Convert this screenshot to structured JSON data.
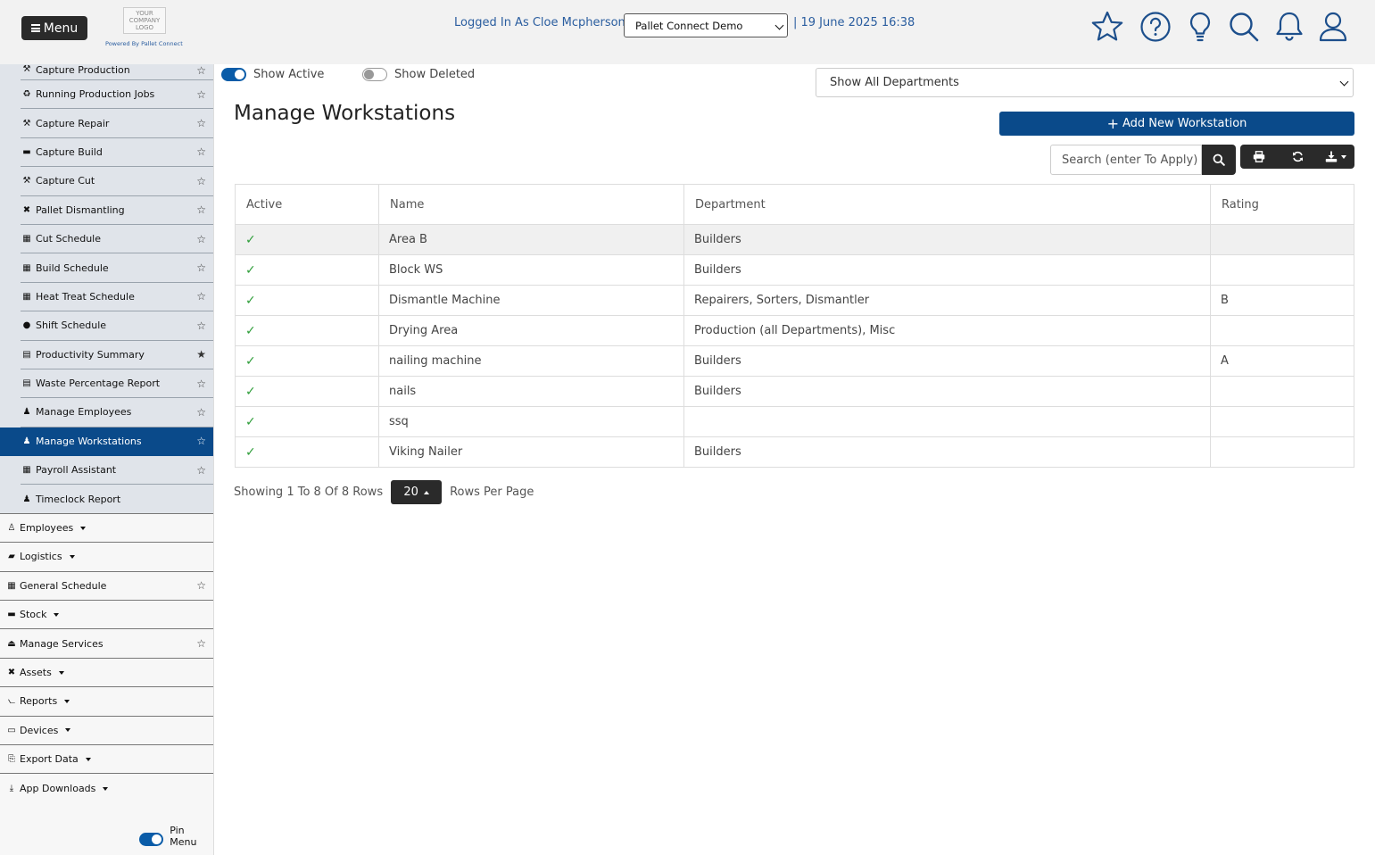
{
  "header": {
    "menu_label": "Menu",
    "logo_text": "YOUR COMPANY LOGO",
    "powered_by": "Powered By Pallet Connect",
    "logged_in": "Logged In As Cloe Mcpherson  |",
    "company": "Pallet Connect Demo",
    "datetime": "| 19 June 2025 16:38",
    "icons": [
      "star-icon",
      "help-icon",
      "lightbulb-icon",
      "search-icon",
      "bell-icon",
      "user-icon"
    ]
  },
  "sidebar": {
    "sub_items": [
      {
        "label": "Capture Production",
        "glyph": "⚒",
        "starred": false
      },
      {
        "label": "Running Production Jobs",
        "glyph": "♻",
        "starred": false
      },
      {
        "label": "Capture Repair",
        "glyph": "⚒",
        "starred": false
      },
      {
        "label": "Capture Build",
        "glyph": "▬",
        "starred": false
      },
      {
        "label": "Capture Cut",
        "glyph": "⚒",
        "starred": false
      },
      {
        "label": "Pallet Dismantling",
        "glyph": "✖",
        "starred": false
      },
      {
        "label": "Cut Schedule",
        "glyph": "▦",
        "starred": false
      },
      {
        "label": "Build Schedule",
        "glyph": "▦",
        "starred": false
      },
      {
        "label": "Heat Treat Schedule",
        "glyph": "▦",
        "starred": false
      },
      {
        "label": "Shift Schedule",
        "glyph": "●",
        "starred": false
      },
      {
        "label": "Productivity Summary",
        "glyph": "▤",
        "starred": true
      },
      {
        "label": "Waste Percentage Report",
        "glyph": "▤",
        "starred": false
      },
      {
        "label": "Manage Employees",
        "glyph": "♟",
        "starred": false
      },
      {
        "label": "Manage Workstations",
        "glyph": "♟",
        "starred": false,
        "active": true
      },
      {
        "label": "Payroll Assistant",
        "glyph": "▦",
        "starred": false
      },
      {
        "label": "Timeclock Report",
        "glyph": "♟",
        "starred": null
      }
    ],
    "main_items": [
      {
        "label": "Employees",
        "glyph": "♙",
        "dropdown": true
      },
      {
        "label": "Logistics",
        "glyph": "▰",
        "dropdown": true
      },
      {
        "label": "General Schedule",
        "glyph": "▦",
        "dropdown": false,
        "star": true
      },
      {
        "label": "Stock",
        "glyph": "▬",
        "dropdown": true
      },
      {
        "label": "Manage Services",
        "glyph": "⏏",
        "dropdown": false,
        "star": true
      },
      {
        "label": "Assets",
        "glyph": "✖",
        "dropdown": true
      },
      {
        "label": "Reports",
        "glyph": "⦦",
        "dropdown": true
      },
      {
        "label": "Devices",
        "glyph": "▭",
        "dropdown": true
      },
      {
        "label": "Export Data",
        "glyph": "⎘",
        "dropdown": true
      },
      {
        "label": "App Downloads",
        "glyph": "⤓",
        "dropdown": true
      }
    ],
    "pin_label": "Pin Menu"
  },
  "filters": {
    "show_active": "Show Active",
    "show_deleted": "Show Deleted",
    "department": "Show All Departments"
  },
  "page": {
    "title": "Manage Workstations",
    "add_button": "Add New Workstation",
    "search_placeholder": "Search (enter To Apply)"
  },
  "table": {
    "columns": [
      "Active",
      "Name",
      "Department",
      "Rating"
    ],
    "rows": [
      {
        "active": "✓",
        "name": "Area B",
        "department": "Builders",
        "rating": ""
      },
      {
        "active": "✓",
        "name": "Block WS",
        "department": "Builders",
        "rating": ""
      },
      {
        "active": "✓",
        "name": "Dismantle Machine",
        "department": "Repairers, Sorters, Dismantler",
        "rating": "B"
      },
      {
        "active": "✓",
        "name": "Drying Area",
        "department": "Production (all Departments), Misc",
        "rating": ""
      },
      {
        "active": "✓",
        "name": "nailing machine",
        "department": "Builders",
        "rating": "A"
      },
      {
        "active": "✓",
        "name": "nails",
        "department": "Builders",
        "rating": ""
      },
      {
        "active": "✓",
        "name": "ssq",
        "department": "",
        "rating": ""
      },
      {
        "active": "✓",
        "name": "Viking Nailer",
        "department": "Builders",
        "rating": ""
      }
    ]
  },
  "pagination": {
    "showing": "Showing 1 To 8 Of 8 Rows",
    "per_page": "20",
    "per_page_label": "Rows Per Page"
  },
  "colors": {
    "primary": "#0a4a8a",
    "link": "#2a5d9f",
    "check": "#2f9e3a",
    "dark_button": "#2a2a2a"
  }
}
